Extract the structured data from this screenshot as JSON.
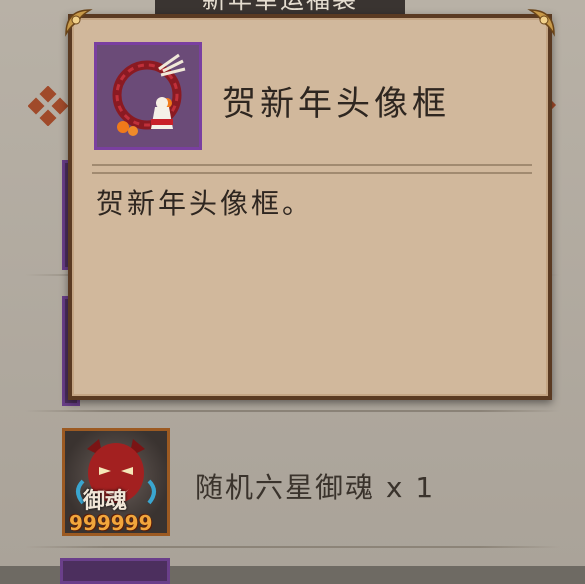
{
  "background": {
    "title": "新年幸运福袋"
  },
  "tooltip": {
    "icon": "new-year-avatar-frame-icon",
    "title": "贺新年头像框",
    "description": "贺新年头像框。"
  },
  "reward_item": {
    "icon": "six-star-soul-icon",
    "icon_caption": "御魂",
    "icon_count": "999999",
    "label": "随机六星御魂 x 1"
  },
  "colors": {
    "tooltip_bg": "#d1b89c",
    "tooltip_border": "#5a3a22",
    "rarity_purple": "#7a3fa0",
    "item_border_orange": "#9c5a22"
  }
}
